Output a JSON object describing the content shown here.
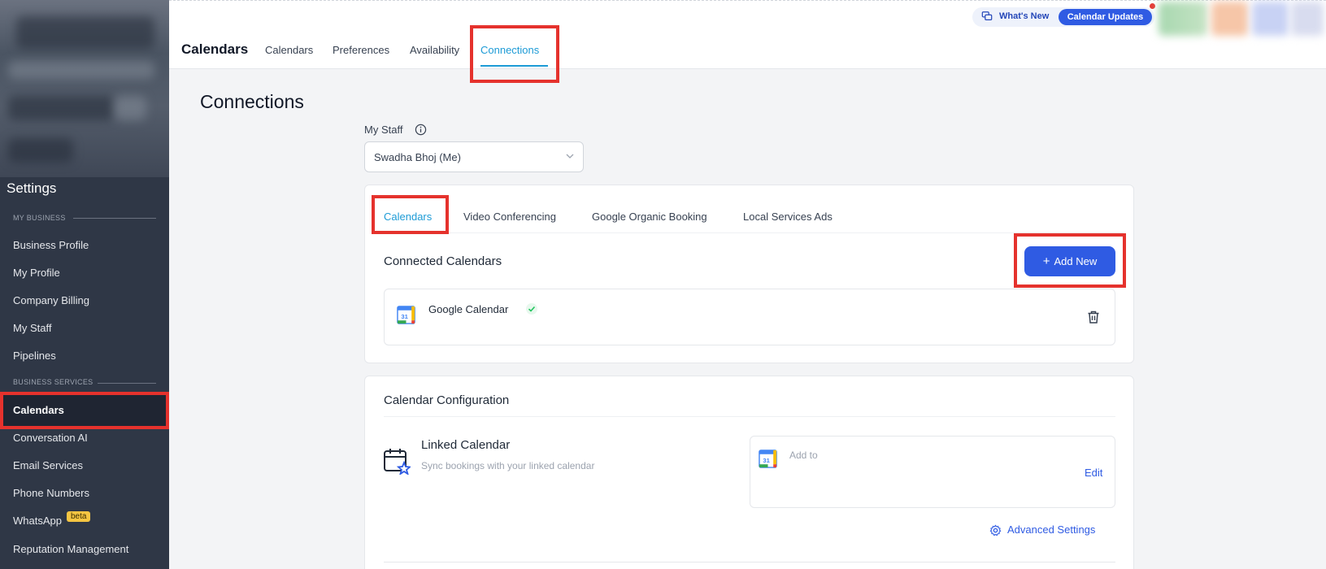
{
  "header": {
    "app_title": "Calendars",
    "tabs": [
      {
        "label": "Calendars"
      },
      {
        "label": "Preferences"
      },
      {
        "label": "Availability"
      },
      {
        "label": "Connections"
      }
    ],
    "whats_new": "What's New",
    "updates_badge": "Calendar Updates"
  },
  "sidebar": {
    "title": "Settings",
    "sections": [
      {
        "label": "MY BUSINESS",
        "items": [
          "Business Profile",
          "My Profile",
          "Company Billing",
          "My Staff",
          "Pipelines"
        ]
      },
      {
        "label": "BUSINESS SERVICES",
        "items": [
          "Calendars",
          "Conversation AI",
          "Email Services",
          "Phone Numbers",
          "WhatsApp",
          "Reputation Management"
        ]
      }
    ],
    "active_item": "Calendars",
    "beta_label": "beta"
  },
  "page": {
    "title": "Connections",
    "staff_label": "My Staff",
    "staff_value": "Swadha Bhoj (Me)",
    "inner_tabs": [
      "Calendars",
      "Video Conferencing",
      "Google Organic Booking",
      "Local Services Ads"
    ],
    "connected_title": "Connected Calendars",
    "add_new_label": "Add New",
    "google_calendar_label": "Google Calendar",
    "google_calendar_day": "31",
    "config_title": "Calendar Configuration",
    "linked_title": "Linked Calendar",
    "linked_desc": "Sync bookings with your linked calendar",
    "add_to_label": "Add to",
    "edit_label": "Edit",
    "advanced_settings_label": "Advanced Settings"
  },
  "colors": {
    "accent": "#2f5be3",
    "tab_active": "#1d9bd6",
    "sidebar_bg": "#2f3746",
    "highlight": "#e5322d",
    "check": "#22c55e"
  }
}
